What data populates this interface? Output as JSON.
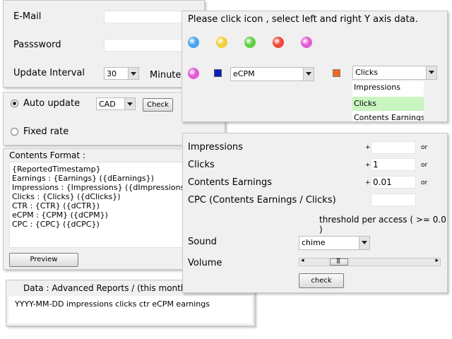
{
  "login": {
    "email_label": "E-Mail",
    "password_label": "Passsword",
    "interval_label": "Update Interval",
    "interval_value": "30",
    "minutes_label": "Minutes"
  },
  "update": {
    "auto_label": "Auto update",
    "currency_value": "CAD",
    "check_label": "Check",
    "fixed_label": "Fixed rate"
  },
  "contents": {
    "title": "Contents Format :",
    "lines": [
      "{ReportedTimestamp}",
      "Earnings : {Earnings} ({dEarnings})",
      "Impressions :  {Impressions} ({dImpressions})",
      "Clicks : {Clicks} ({dClicks})",
      "CTR : {CTR} ({dCTR})",
      "eCPM : {CPM} ({dCPM})",
      "CPC : {CPC} ({dCPC})"
    ],
    "preview_label": "Preview"
  },
  "data_panel": {
    "title": "Data :  Advanced Reports / (this month) / CSV data",
    "content": "YYYY-MM-DD impressions clicks ctr eCPM earnings"
  },
  "axis": {
    "instruction": "Please click icon , select left and right Y axis data.",
    "icon_colors": [
      "#4aa3ef",
      "#f0d23c",
      "#5fd045",
      "#ef4a3c",
      "#e25bd3"
    ],
    "selected_color": "#e25bd3",
    "left_color": "#0a1ec8",
    "right_color": "#f06a1e",
    "left_value": "eCPM",
    "right_value": "Clicks",
    "dropdown_options": [
      "Impressions",
      "Clicks",
      "Contents Earnings"
    ],
    "dropdown_highlighted": "Clicks",
    "highlight_color": "#c8f5c0"
  },
  "threshold": {
    "rows": [
      {
        "label": "Impressions",
        "sign": "+",
        "value": "",
        "suffix": "or"
      },
      {
        "label": "Clicks",
        "sign": "+",
        "value": "1",
        "suffix": "or"
      },
      {
        "label": "Contents Earnings",
        "sign": "+",
        "value": "0.01",
        "suffix": "or"
      },
      {
        "label": "CPC (Contents Earnings / Clicks)",
        "sign": "",
        "value": "",
        "suffix": ""
      }
    ],
    "threshold_label": "threshold per access ( >= 0.0 )",
    "sound_label": "Sound",
    "sound_value": "chime",
    "volume_label": "Volume",
    "volume_level": 0.25,
    "check_label": "check"
  }
}
